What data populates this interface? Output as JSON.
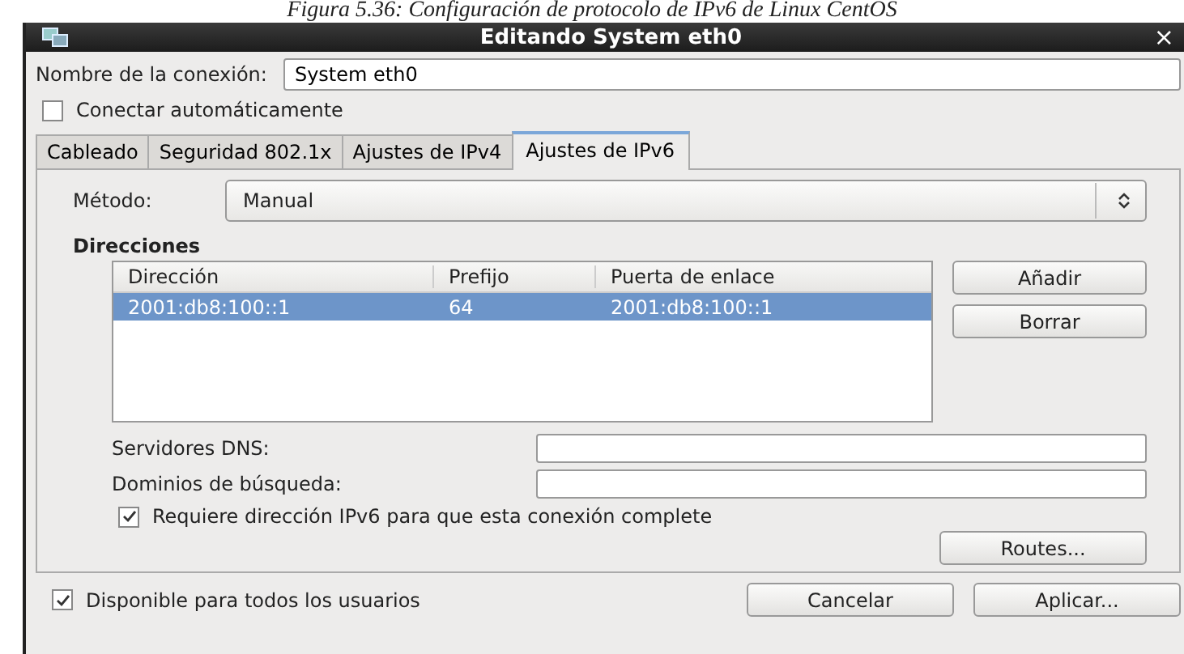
{
  "caption": "Figura 5.36: Configuración de protocolo de IPv6 de Linux CentOS",
  "window": {
    "title": "Editando System eth0",
    "close": "×"
  },
  "connection_name": {
    "label": "Nombre de la conexión:",
    "value": "System eth0"
  },
  "auto_connect": {
    "label": "Conectar automáticamente",
    "checked": false
  },
  "tabs": [
    {
      "label": "Cableado",
      "selected": false
    },
    {
      "label": "Seguridad 802.1x",
      "selected": false
    },
    {
      "label": "Ajustes de IPv4",
      "selected": false
    },
    {
      "label": "Ajustes de IPv6",
      "selected": true
    }
  ],
  "method": {
    "label": "Método:",
    "value": "Manual"
  },
  "addresses": {
    "heading": "Direcciones",
    "columns": [
      "Dirección",
      "Prefijo",
      "Puerta de enlace"
    ],
    "rows": [
      {
        "cells": [
          "2001:db8:100::1",
          "64",
          "2001:db8:100::1"
        ],
        "selected": true
      }
    ],
    "buttons": [
      "Añadir",
      "Borrar"
    ]
  },
  "dns": {
    "label": "Servidores DNS:"
  },
  "search_domains": {
    "label": "Dominios de búsqueda:"
  },
  "require_ipv6": {
    "label": "Requiere dirección IPv6 para que esta conexión complete",
    "checked": true
  },
  "routes_button": "Routes...",
  "all_users": {
    "label": "Disponible para todos los usuarios",
    "checked": true
  },
  "buttons": [
    "Cancelar",
    "Aplicar..."
  ]
}
